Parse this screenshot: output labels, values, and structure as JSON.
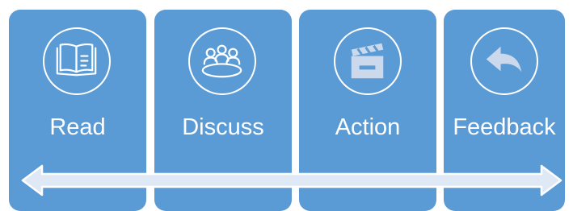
{
  "steps": [
    {
      "label": "Read",
      "icon": "open-book-icon"
    },
    {
      "label": "Discuss",
      "icon": "meeting-table-icon"
    },
    {
      "label": "Action",
      "icon": "clapperboard-icon"
    },
    {
      "label": "Feedback",
      "icon": "reply-arrow-icon"
    }
  ],
  "colors": {
    "card": "#5b9bd5",
    "card_dark": "#4a86c2",
    "arrow_fill": "#dfe9f5",
    "arrow_stroke": "#ffffff",
    "icon_stroke": "#ffffff",
    "icon_fill": "#ccd9ed"
  }
}
